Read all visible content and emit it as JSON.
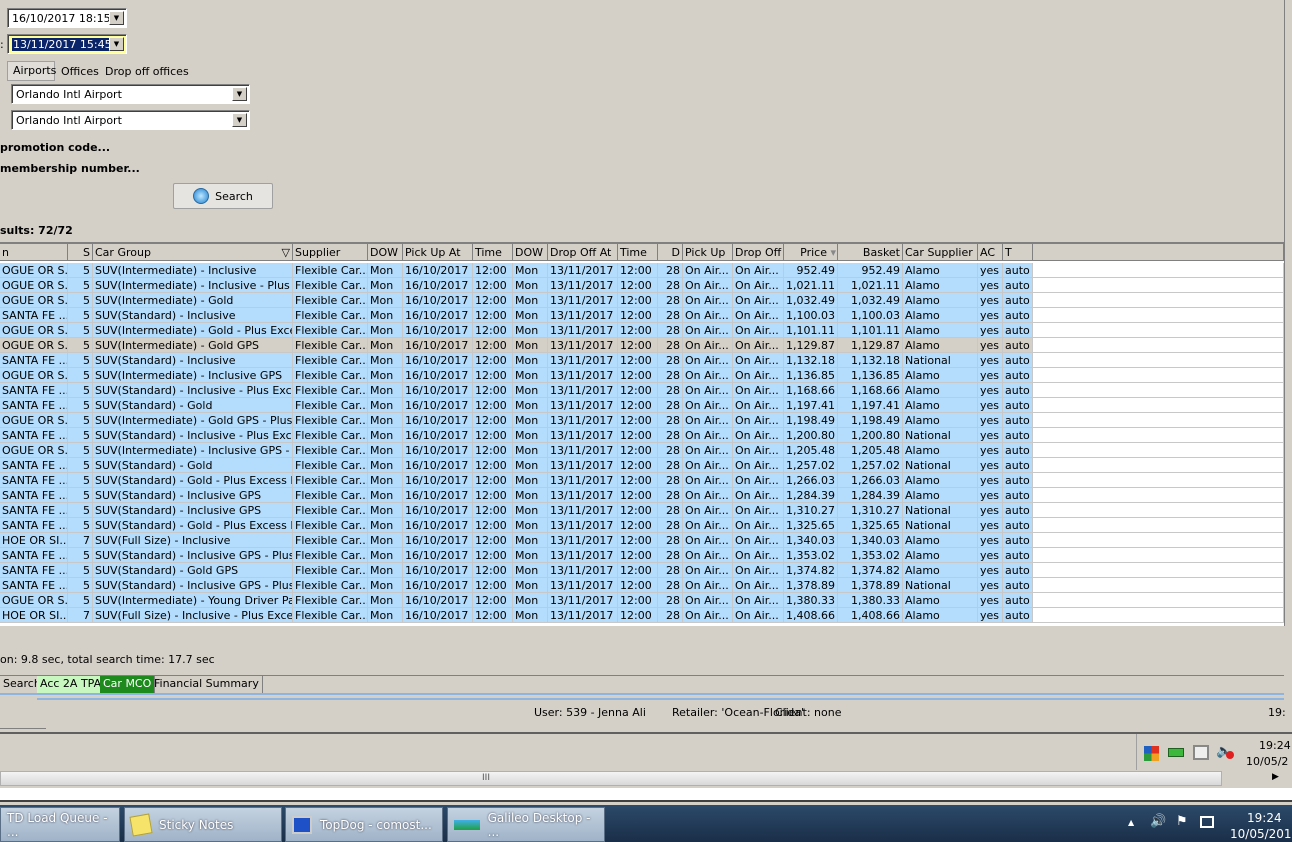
{
  "form": {
    "pickup_datetime": "16/10/2017 18:15",
    "dropoff_label_fragment": ":",
    "dropoff_datetime": "13/11/2017 15:45",
    "location_tabs": [
      "Airports",
      "Offices",
      "Drop off offices"
    ],
    "pickup_location": "Orlando Intl Airport",
    "dropoff_location": "Orlando Intl Airport",
    "promotion_link": "promotion code...",
    "membership_link": "membership number...",
    "search_label": "Search",
    "results_label": "sults: 72/72"
  },
  "grid": {
    "columns": [
      "n",
      "S",
      "Car Group",
      "Supplier",
      "DOW",
      "Pick Up At",
      "Time",
      "DOW",
      "Drop Off At",
      "Time",
      "D",
      "Pick Up",
      "Drop Off",
      "Price",
      "Basket",
      "Car Supplier",
      "AC",
      "T"
    ],
    "selected_row": 5,
    "rows": [
      [
        "OGUE OR S...",
        "5",
        "SUV(Intermediate) - Inclusive",
        "Flexible Car...",
        "Mon",
        "16/10/2017",
        "12:00",
        "Mon",
        "13/11/2017",
        "12:00",
        "28",
        "On Air...",
        "On Air...",
        "952.49",
        "952.49",
        "Alamo",
        "yes",
        "auto"
      ],
      [
        "OGUE OR S...",
        "5",
        "SUV(Intermediate) - Inclusive - Plus E...",
        "Flexible Car...",
        "Mon",
        "16/10/2017",
        "12:00",
        "Mon",
        "13/11/2017",
        "12:00",
        "28",
        "On Air...",
        "On Air...",
        "1,021.11",
        "1,021.11",
        "Alamo",
        "yes",
        "auto"
      ],
      [
        "OGUE OR S...",
        "5",
        "SUV(Intermediate) - Gold",
        "Flexible Car...",
        "Mon",
        "16/10/2017",
        "12:00",
        "Mon",
        "13/11/2017",
        "12:00",
        "28",
        "On Air...",
        "On Air...",
        "1,032.49",
        "1,032.49",
        "Alamo",
        "yes",
        "auto"
      ],
      [
        "SANTA FE ...",
        "5",
        "SUV(Standard) - Inclusive",
        "Flexible Car...",
        "Mon",
        "16/10/2017",
        "12:00",
        "Mon",
        "13/11/2017",
        "12:00",
        "28",
        "On Air...",
        "On Air...",
        "1,100.03",
        "1,100.03",
        "Alamo",
        "yes",
        "auto"
      ],
      [
        "OGUE OR S...",
        "5",
        "SUV(Intermediate) - Gold - Plus Exces...",
        "Flexible Car...",
        "Mon",
        "16/10/2017",
        "12:00",
        "Mon",
        "13/11/2017",
        "12:00",
        "28",
        "On Air...",
        "On Air...",
        "1,101.11",
        "1,101.11",
        "Alamo",
        "yes",
        "auto"
      ],
      [
        "OGUE OR S...",
        "5",
        "SUV(Intermediate) - Gold GPS",
        "Flexible Car...",
        "Mon",
        "16/10/2017",
        "12:00",
        "Mon",
        "13/11/2017",
        "12:00",
        "28",
        "On Air...",
        "On Air...",
        "1,129.87",
        "1,129.87",
        "Alamo",
        "yes",
        "auto"
      ],
      [
        "SANTA FE ...",
        "5",
        "SUV(Standard) - Inclusive",
        "Flexible Car...",
        "Mon",
        "16/10/2017",
        "12:00",
        "Mon",
        "13/11/2017",
        "12:00",
        "28",
        "On Air...",
        "On Air...",
        "1,132.18",
        "1,132.18",
        "National",
        "yes",
        "auto"
      ],
      [
        "OGUE OR S...",
        "5",
        "SUV(Intermediate) - Inclusive GPS",
        "Flexible Car...",
        "Mon",
        "16/10/2017",
        "12:00",
        "Mon",
        "13/11/2017",
        "12:00",
        "28",
        "On Air...",
        "On Air...",
        "1,136.85",
        "1,136.85",
        "Alamo",
        "yes",
        "auto"
      ],
      [
        "SANTA FE ...",
        "5",
        "SUV(Standard) - Inclusive - Plus Exce...",
        "Flexible Car...",
        "Mon",
        "16/10/2017",
        "12:00",
        "Mon",
        "13/11/2017",
        "12:00",
        "28",
        "On Air...",
        "On Air...",
        "1,168.66",
        "1,168.66",
        "Alamo",
        "yes",
        "auto"
      ],
      [
        "SANTA FE ...",
        "5",
        "SUV(Standard) - Gold",
        "Flexible Car...",
        "Mon",
        "16/10/2017",
        "12:00",
        "Mon",
        "13/11/2017",
        "12:00",
        "28",
        "On Air...",
        "On Air...",
        "1,197.41",
        "1,197.41",
        "Alamo",
        "yes",
        "auto"
      ],
      [
        "OGUE OR S...",
        "5",
        "SUV(Intermediate) - Gold GPS - Plus E...",
        "Flexible Car...",
        "Mon",
        "16/10/2017",
        "12:00",
        "Mon",
        "13/11/2017",
        "12:00",
        "28",
        "On Air...",
        "On Air...",
        "1,198.49",
        "1,198.49",
        "Alamo",
        "yes",
        "auto"
      ],
      [
        "SANTA FE ...",
        "5",
        "SUV(Standard) - Inclusive - Plus Exce...",
        "Flexible Car...",
        "Mon",
        "16/10/2017",
        "12:00",
        "Mon",
        "13/11/2017",
        "12:00",
        "28",
        "On Air...",
        "On Air...",
        "1,200.80",
        "1,200.80",
        "National",
        "yes",
        "auto"
      ],
      [
        "OGUE OR S...",
        "5",
        "SUV(Intermediate) - Inclusive GPS - Pl...",
        "Flexible Car...",
        "Mon",
        "16/10/2017",
        "12:00",
        "Mon",
        "13/11/2017",
        "12:00",
        "28",
        "On Air...",
        "On Air...",
        "1,205.48",
        "1,205.48",
        "Alamo",
        "yes",
        "auto"
      ],
      [
        "SANTA FE ...",
        "5",
        "SUV(Standard) - Gold",
        "Flexible Car...",
        "Mon",
        "16/10/2017",
        "12:00",
        "Mon",
        "13/11/2017",
        "12:00",
        "28",
        "On Air...",
        "On Air...",
        "1,257.02",
        "1,257.02",
        "National",
        "yes",
        "auto"
      ],
      [
        "SANTA FE ...",
        "5",
        "SUV(Standard) - Gold - Plus Excess R...",
        "Flexible Car...",
        "Mon",
        "16/10/2017",
        "12:00",
        "Mon",
        "13/11/2017",
        "12:00",
        "28",
        "On Air...",
        "On Air...",
        "1,266.03",
        "1,266.03",
        "Alamo",
        "yes",
        "auto"
      ],
      [
        "SANTA FE ...",
        "5",
        "SUV(Standard) - Inclusive GPS",
        "Flexible Car...",
        "Mon",
        "16/10/2017",
        "12:00",
        "Mon",
        "13/11/2017",
        "12:00",
        "28",
        "On Air...",
        "On Air...",
        "1,284.39",
        "1,284.39",
        "Alamo",
        "yes",
        "auto"
      ],
      [
        "SANTA FE ...",
        "5",
        "SUV(Standard) - Inclusive GPS",
        "Flexible Car...",
        "Mon",
        "16/10/2017",
        "12:00",
        "Mon",
        "13/11/2017",
        "12:00",
        "28",
        "On Air...",
        "On Air...",
        "1,310.27",
        "1,310.27",
        "National",
        "yes",
        "auto"
      ],
      [
        "SANTA FE ...",
        "5",
        "SUV(Standard) - Gold - Plus Excess R...",
        "Flexible Car...",
        "Mon",
        "16/10/2017",
        "12:00",
        "Mon",
        "13/11/2017",
        "12:00",
        "28",
        "On Air...",
        "On Air...",
        "1,325.65",
        "1,325.65",
        "National",
        "yes",
        "auto"
      ],
      [
        "HOE OR SI...",
        "7",
        "SUV(Full Size) - Inclusive",
        "Flexible Car...",
        "Mon",
        "16/10/2017",
        "12:00",
        "Mon",
        "13/11/2017",
        "12:00",
        "28",
        "On Air...",
        "On Air...",
        "1,340.03",
        "1,340.03",
        "Alamo",
        "yes",
        "auto"
      ],
      [
        "SANTA FE ...",
        "5",
        "SUV(Standard) - Inclusive GPS - Plus ...",
        "Flexible Car...",
        "Mon",
        "16/10/2017",
        "12:00",
        "Mon",
        "13/11/2017",
        "12:00",
        "28",
        "On Air...",
        "On Air...",
        "1,353.02",
        "1,353.02",
        "Alamo",
        "yes",
        "auto"
      ],
      [
        "SANTA FE ...",
        "5",
        "SUV(Standard) - Gold GPS",
        "Flexible Car...",
        "Mon",
        "16/10/2017",
        "12:00",
        "Mon",
        "13/11/2017",
        "12:00",
        "28",
        "On Air...",
        "On Air...",
        "1,374.82",
        "1,374.82",
        "Alamo",
        "yes",
        "auto"
      ],
      [
        "SANTA FE ...",
        "5",
        "SUV(Standard) - Inclusive GPS - Plus ...",
        "Flexible Car...",
        "Mon",
        "16/10/2017",
        "12:00",
        "Mon",
        "13/11/2017",
        "12:00",
        "28",
        "On Air...",
        "On Air...",
        "1,378.89",
        "1,378.89",
        "National",
        "yes",
        "auto"
      ],
      [
        "OGUE OR S...",
        "5",
        "SUV(Intermediate) - Young Driver Pac...",
        "Flexible Car...",
        "Mon",
        "16/10/2017",
        "12:00",
        "Mon",
        "13/11/2017",
        "12:00",
        "28",
        "On Air...",
        "On Air...",
        "1,380.33",
        "1,380.33",
        "Alamo",
        "yes",
        "auto"
      ],
      [
        "HOE OR SI...",
        "7",
        "SUV(Full Size) - Inclusive - Plus Excess...",
        "Flexible Car...",
        "Mon",
        "16/10/2017",
        "12:00",
        "Mon",
        "13/11/2017",
        "12:00",
        "28",
        "On Air...",
        "On Air...",
        "1,408.66",
        "1,408.66",
        "Alamo",
        "yes",
        "auto"
      ]
    ]
  },
  "timing_text": "on: 9.8 sec, total search time: 17.7 sec",
  "bottom_tabs": [
    "Search",
    "Acc 2A TPA",
    "Car MCO",
    "Financial Summary"
  ],
  "status": {
    "user": "User: 539 - Jenna Ali",
    "retailer": "Retailer: 'Ocean-Florida'",
    "client": "Client: none",
    "time_fragment": "19:"
  },
  "inner_tray": {
    "time": "19:24",
    "date": "10/05/2"
  },
  "scroll_grip": "III",
  "taskbar": {
    "items": [
      "TD Load Queue - ...",
      "Sticky Notes",
      "TopDog - comost...",
      "Galileo Desktop - ..."
    ],
    "time": "19:24",
    "date": "10/05/2017"
  },
  "colors": {
    "row": "#b4dcfc",
    "selected_row": "#d4d0c8",
    "tab_acc": "#c8f8c0",
    "tab_car": "#1e8a1e",
    "highlight_input": "#ffff99"
  }
}
